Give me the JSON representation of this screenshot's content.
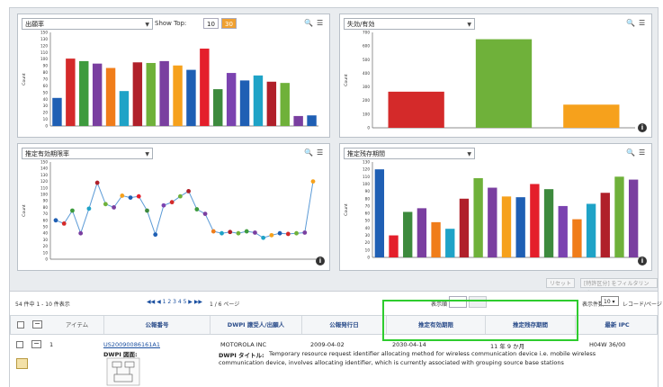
{
  "panel1": {
    "dropdown": "出願率",
    "show_top_label": "Show Top:",
    "show_top_options": [
      "10",
      "30"
    ],
    "ylabel": "Count",
    "yticks": [
      "150",
      "130",
      "120",
      "110",
      "100",
      "90",
      "80",
      "70",
      "60",
      "50",
      "40",
      "30",
      "20",
      "10",
      "0"
    ],
    "ymax": 150
  },
  "panel2": {
    "dropdown": "失効/有効",
    "ylabel": "Count",
    "yticks": [
      "700",
      "600",
      "500",
      "400",
      "300",
      "200",
      "100",
      "0"
    ],
    "ymax": 700
  },
  "panel3": {
    "dropdown": "推定有効期限率",
    "ylabel": "Count",
    "yticks": [
      "150",
      "140",
      "130",
      "120",
      "110",
      "100",
      "90",
      "80",
      "70",
      "60",
      "50",
      "40",
      "30",
      "20",
      "10",
      "0"
    ],
    "ymax": 150
  },
  "panel4": {
    "dropdown": "推定残存期間",
    "ylabel": "Count",
    "yticks": [
      "130",
      "120",
      "110",
      "100",
      "90",
      "80",
      "70",
      "60",
      "50",
      "40",
      "30",
      "20",
      "10",
      "0"
    ],
    "ymax": 130
  },
  "chart_data": [
    {
      "type": "bar",
      "ylabel": "Count",
      "ylim": [
        0,
        150
      ],
      "values": [
        45,
        108,
        104,
        100,
        93,
        56,
        102,
        101,
        104,
        97,
        90,
        124,
        59,
        85,
        73,
        81,
        71,
        69,
        16,
        17
      ],
      "colors": [
        "#1f5fb4",
        "#d42a2a",
        "#3d9b3d",
        "#7a3fa0",
        "#f07d1a",
        "#1fa3c7",
        "#b0202a",
        "#6fb13a",
        "#7a3fa0",
        "#f6a11c",
        "#1f5fb4",
        "#e41f2b",
        "#3d8a3d",
        "#7b43b0",
        "#1f5fb4",
        "#1fa3c7",
        "#b0202a",
        "#6fb13a",
        "#7a3fa0",
        "#1f5fb4"
      ]
    },
    {
      "type": "bar",
      "ylabel": "Count",
      "ylim": [
        0,
        700
      ],
      "values": [
        265,
        650,
        170
      ],
      "colors": [
        "#d42a2a",
        "#6fb13a",
        "#f6a11c"
      ]
    },
    {
      "type": "line",
      "ylabel": "Count",
      "ylim": [
        0,
        150
      ],
      "values": [
        60,
        55,
        75,
        40,
        78,
        118,
        85,
        80,
        98,
        95,
        97,
        75,
        38,
        83,
        88,
        97,
        105,
        77,
        70,
        43,
        40,
        42,
        40,
        43,
        41,
        33,
        37,
        40,
        39,
        40,
        41,
        120
      ],
      "colors": [
        "#1f5fb4",
        "#d42a2a",
        "#3d9b3d",
        "#7a3fa0",
        "#1fa3c7",
        "#b0202a",
        "#6fb13a",
        "#7a3fa0",
        "#f6a11c",
        "#1f5fb4",
        "#e41f2b",
        "#3d8a3d",
        "#1f5fb4",
        "#7b43b0",
        "#d42a2a",
        "#6fb13a",
        "#b0202a",
        "#3d9b3d",
        "#7a3fa0",
        "#f07d1a",
        "#1fa3c7",
        "#b0202a",
        "#6fb13a",
        "#3d9b3d",
        "#7a3fa0",
        "#1fa3c7",
        "#f6a11c",
        "#1f5fb4",
        "#d42a2a",
        "#6fb13a",
        "#7a3fa0",
        "#f6a11c"
      ]
    },
    {
      "type": "bar",
      "ylabel": "Count",
      "ylim": [
        0,
        130
      ],
      "values": [
        120,
        30,
        62,
        67,
        48,
        39,
        80,
        108,
        95,
        83,
        82,
        100,
        93,
        70,
        52,
        73,
        88,
        110,
        106
      ],
      "colors": [
        "#1f5fb4",
        "#e41f2b",
        "#3d8a3d",
        "#7a3fa0",
        "#f07d1a",
        "#1fa3c7",
        "#b0202a",
        "#6fb13a",
        "#7a3fa0",
        "#f6a11c",
        "#1f5fb4",
        "#e41f2b",
        "#3d8a3d",
        "#7b43b0",
        "#f07d1a",
        "#1fa3c7",
        "#b0202a",
        "#6fb13a",
        "#7a3fa0"
      ]
    }
  ],
  "buttons": {
    "reset": "リセット",
    "filter": "[特許区分] をフィルタリング"
  },
  "results": {
    "count_text": "54 件中 1 - 10 件表示",
    "pager_text": "1 2 3 4 5",
    "pager_pages": "1 / 6 ページ",
    "sort_label": "表示順",
    "per_page_label": "表示件数",
    "per_page_value": "10",
    "per_page_suffix": "レコード/ページ"
  },
  "table": {
    "headers": [
      "アイテム",
      "公報番号",
      "DWPI 譲受人/出願人",
      "公報発行日",
      "推定有効期限",
      "推定残存期間",
      "最新 IPC"
    ],
    "row": {
      "item": "1",
      "number": "US20090086161A1",
      "assignee": "MOTOROLA INC",
      "pub_date": "2009-04-02",
      "expiry": "2030-04-14",
      "remaining": "11 年 9 か月",
      "ipc": "H04W 36/00",
      "drawing_label": "DWPI 図面:",
      "title_label": "DWPI タイトル:",
      "title_line1": "Temporary resource request identifier allocating method for wireless communication device i.e. mobile wireless",
      "title_line2": "communication device, involves allocating identifier, which is currently associated with grouping source base stations"
    }
  }
}
